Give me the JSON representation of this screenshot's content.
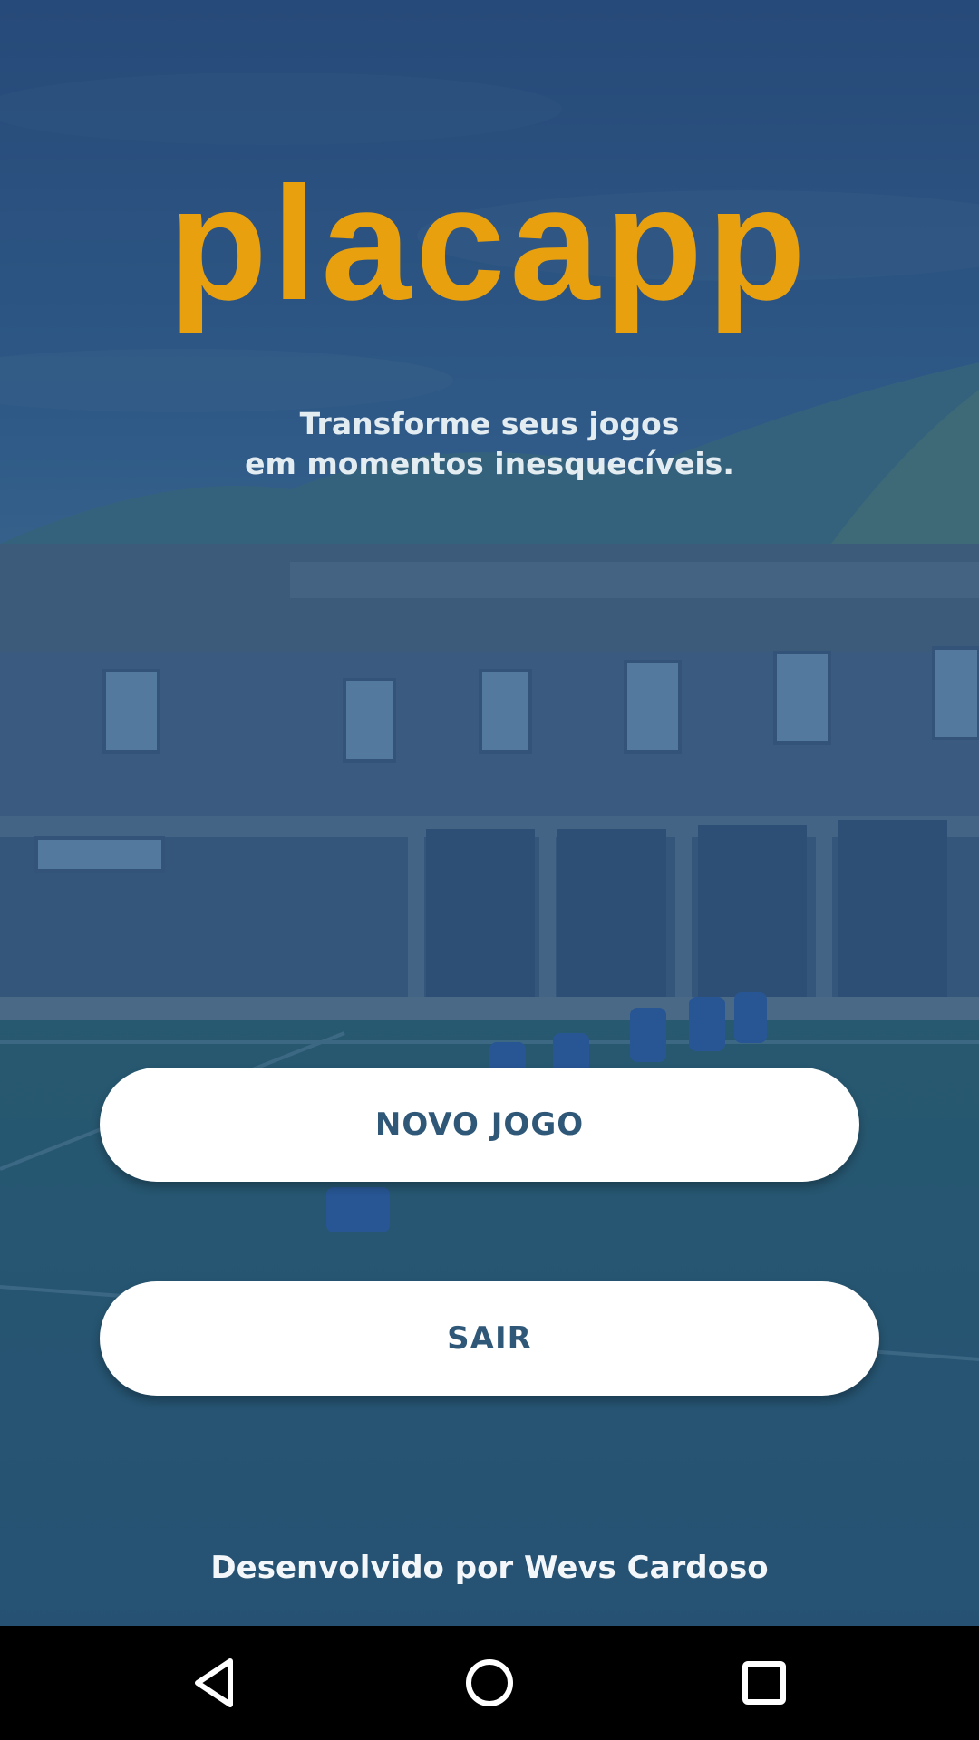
{
  "app": {
    "name": "placapp",
    "tagline": [
      "Transforme seus jogos",
      "em momentos inesquecíveis."
    ]
  },
  "actions": {
    "new_game": "NOVO JOGO",
    "exit": "SAIR"
  },
  "footer": {
    "credits": "Desenvolvido por Wevs Cardoso"
  },
  "system_nav": {
    "back_icon": "triangle-back-icon",
    "home_icon": "circle-home-icon",
    "recents_icon": "square-recents-icon"
  },
  "colors": {
    "brand": "#E8A00F",
    "overlay": "#224A76",
    "button_text": "#2F5878",
    "button_bg": "#FFFFFF",
    "navbar": "#000000"
  }
}
